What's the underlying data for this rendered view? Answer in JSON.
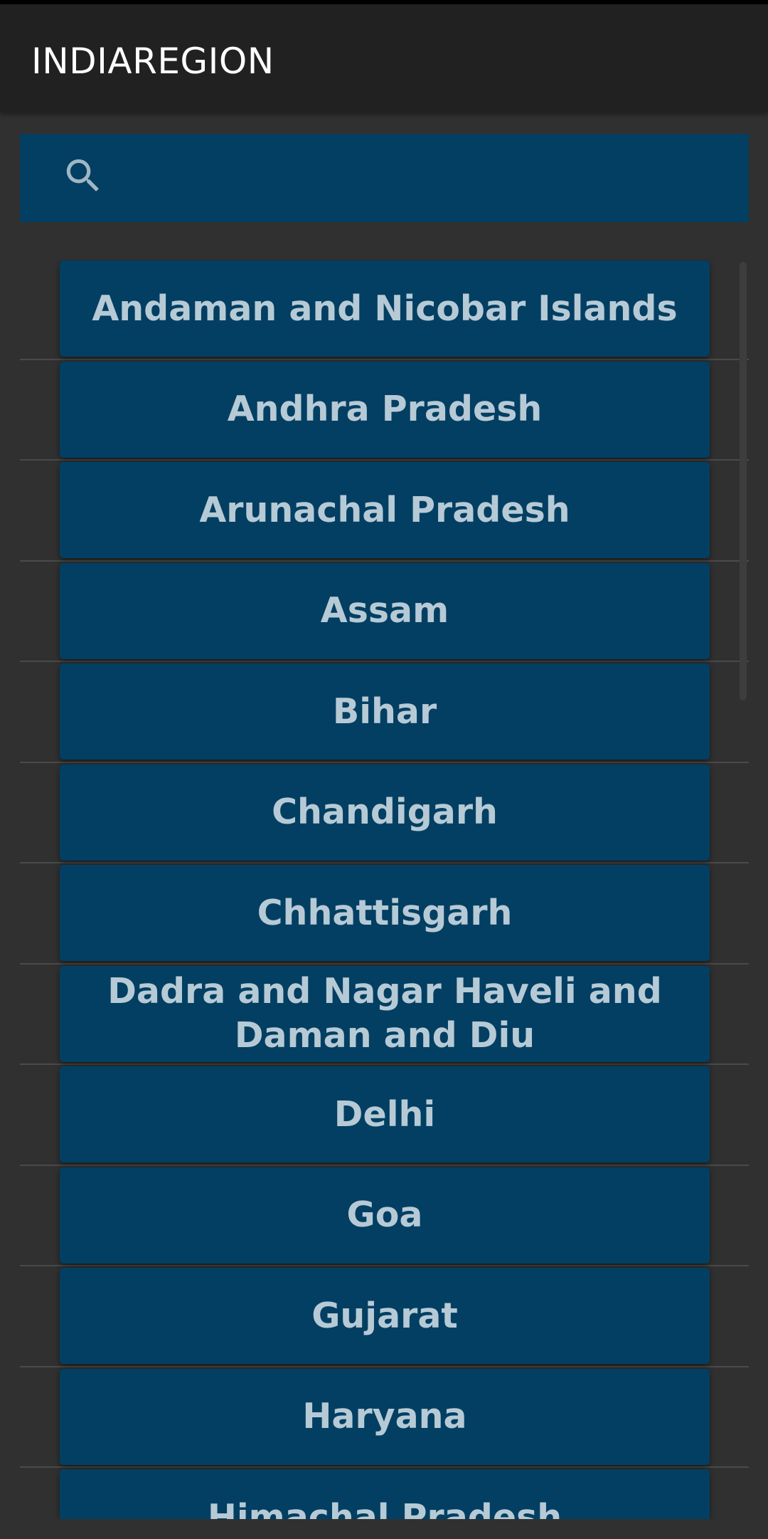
{
  "app": {
    "title": "INDIAREGION"
  },
  "search": {
    "icon": "search-icon",
    "value": "",
    "placeholder": ""
  },
  "colors": {
    "background": "#303030",
    "app_bar": "#212121",
    "card": "#033f62",
    "card_text": "#b6cad6",
    "divider": "#4a4a4a"
  },
  "states": [
    {
      "label": "Andaman and Nicobar Islands"
    },
    {
      "label": "Andhra Pradesh"
    },
    {
      "label": "Arunachal Pradesh"
    },
    {
      "label": "Assam"
    },
    {
      "label": "Bihar"
    },
    {
      "label": "Chandigarh"
    },
    {
      "label": "Chhattisgarh"
    },
    {
      "label": "Dadra and Nagar Haveli and Daman and Diu"
    },
    {
      "label": "Delhi"
    },
    {
      "label": "Goa"
    },
    {
      "label": "Gujarat"
    },
    {
      "label": "Haryana"
    },
    {
      "label": "Himachal Pradesh"
    }
  ]
}
